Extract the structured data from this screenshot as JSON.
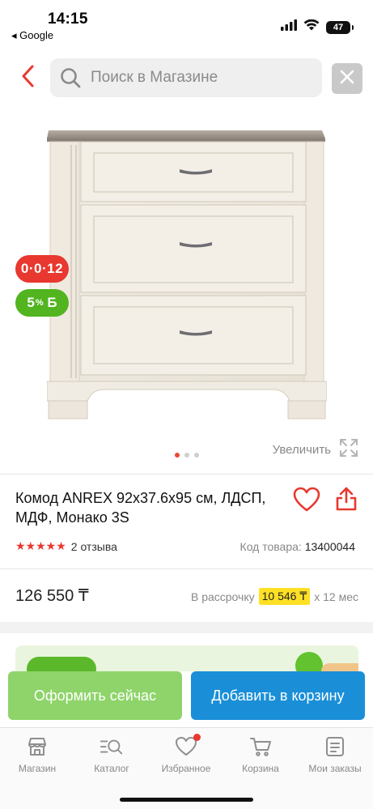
{
  "status_bar": {
    "time": "14:15",
    "back_app": "◂ Google",
    "battery": "47"
  },
  "search": {
    "placeholder": "Поиск в Магазине"
  },
  "badges": {
    "installment": "0·0·12",
    "bonus_value": "5",
    "bonus_suffix": "%",
    "bonus_currency": "Б"
  },
  "gallery": {
    "dots": 3,
    "active_dot": 0,
    "zoom_label": "Увеличить"
  },
  "product": {
    "title": "Комод ANREX 92x37.6x95 см, ЛДСП, МДФ, Монако 3S",
    "stars": "★★★★★",
    "rating": 5,
    "reviews": "2 отзыва",
    "code_label": "Код товара:",
    "code_value": "13400044",
    "price": "126 550 ₸",
    "installment_label": "В рассрочку",
    "installment_amount": "10 546 ₸",
    "installment_term": "x 12 мес"
  },
  "actions": {
    "buy_now": "Оформить сейчас",
    "add_to_cart": "Добавить в корзину"
  },
  "tabs": [
    {
      "label": "Магазин",
      "icon": "store-icon"
    },
    {
      "label": "Каталог",
      "icon": "catalog-search-icon"
    },
    {
      "label": "Избранное",
      "icon": "heart-icon"
    },
    {
      "label": "Корзина",
      "icon": "cart-icon"
    },
    {
      "label": "Мои заказы",
      "icon": "orders-icon"
    }
  ],
  "colors": {
    "accent_red": "#e8382f",
    "bonus_green": "#52b41f",
    "buy_green": "#8ed46a",
    "cart_blue": "#1a8fd8",
    "installment_yellow": "#ffe024"
  }
}
